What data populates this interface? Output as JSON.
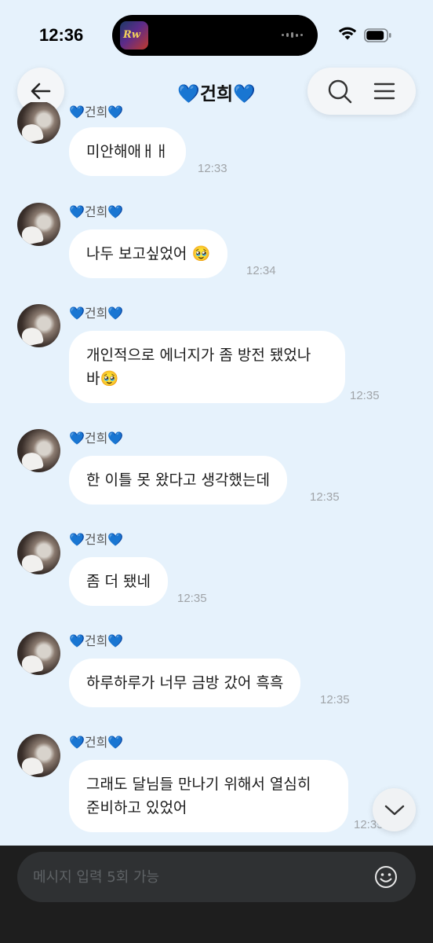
{
  "status_bar": {
    "time": "12:36",
    "live_activity_app": "music-app-icon"
  },
  "header": {
    "title": "💙건희💙",
    "back_icon": "arrow-left-icon",
    "search_icon": "search-icon",
    "menu_icon": "menu-icon"
  },
  "messages": [
    {
      "sender": "💙건희💙",
      "text": "미안해애ㅐㅐ",
      "time": "12:33"
    },
    {
      "sender": "💙건희💙",
      "text": "나두 보고싶었어 🥹",
      "time": "12:34"
    },
    {
      "sender": "💙건희💙",
      "text": "개인적으로 에너지가 좀 방전 됐었나\n바🥹",
      "time": "12:35"
    },
    {
      "sender": "💙건희💙",
      "text": "한 이틀 못 왔다고 생각했는데",
      "time": "12:35"
    },
    {
      "sender": "💙건희💙",
      "text": "좀 더 됐네",
      "time": "12:35"
    },
    {
      "sender": "💙건희💙",
      "text": "하루하루가 너무 금방 갔어 흑흑",
      "time": "12:35"
    },
    {
      "sender": "💙건희💙",
      "text": "그래도 달님들 만나기 위해서 열심히\n준비하고 있었어",
      "time": "12:35"
    }
  ],
  "composer": {
    "placeholder": "메시지 입력 5회 가능",
    "emoji_icon": "smiley-icon"
  },
  "scroll_down_icon": "chevron-down-icon",
  "colors": {
    "background": "#e6f2fc",
    "bubble": "#ffffff",
    "composer": "#1e1e1e",
    "heart": "#2f7de1"
  }
}
